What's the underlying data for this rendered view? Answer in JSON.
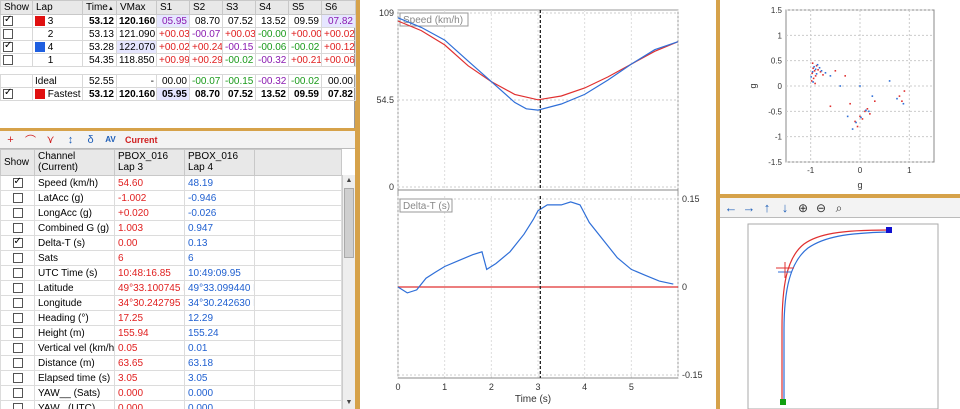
{
  "laps": {
    "headers": [
      "Show",
      "Lap",
      "Time",
      "VMax",
      "S1",
      "S2",
      "S3",
      "S4",
      "S5",
      "S6"
    ],
    "sort_indicator": "▲",
    "rows": [
      {
        "checked": true,
        "color": "#e01010",
        "lap": "3",
        "time": "53.12",
        "vmax": "120.160",
        "s": [
          "05.95",
          "08.70",
          "07.52",
          "13.52",
          "09.59",
          "07.82"
        ]
      },
      {
        "checked": false,
        "color": "",
        "lap": "2",
        "time": "53.13",
        "vmax": "121.090",
        "s": [
          "+00.03",
          "-00.07",
          "+00.03",
          "-00.00",
          "+00.00",
          "+00.02"
        ]
      },
      {
        "checked": true,
        "color": "#1f5fe0",
        "lap": "4",
        "time": "53.28",
        "vmax": "122.070",
        "s": [
          "+00.02",
          "+00.24",
          "-00.15",
          "-00.06",
          "-00.02",
          "+00.12"
        ]
      },
      {
        "checked": false,
        "color": "",
        "lap": "1",
        "time": "54.35",
        "vmax": "118.850",
        "s": [
          "+00.99",
          "+00.29",
          "-00.02",
          "-00.32",
          "+00.21",
          "+00.06"
        ]
      }
    ],
    "ideal": {
      "label": "Ideal",
      "time": "52.55",
      "vmax": "-",
      "s": [
        "00.00",
        "-00.07",
        "-00.15",
        "-00.32",
        "-00.02",
        "00.00"
      ]
    },
    "fastest": {
      "checked": true,
      "color": "#e01010",
      "label": "Fastest",
      "time": "53.12",
      "vmax": "120.160",
      "s": [
        "05.95",
        "08.70",
        "07.52",
        "13.52",
        "09.59",
        "07.82"
      ]
    }
  },
  "channel_toolbar": {
    "icons": [
      "add-marker-icon",
      "curve-icon",
      "split-icon",
      "sort-icon",
      "delta-icon",
      "av-icon"
    ],
    "glyphs": [
      "+",
      "⌒",
      "⋎",
      "↕",
      "δ",
      "AV"
    ],
    "current_label": "Current"
  },
  "channels": {
    "headers": {
      "show": "Show",
      "channel": "Channel",
      "channel_sub": "(Current)",
      "a_name": "PBOX_016",
      "a_lap": "Lap 3",
      "b_name": "PBOX_016",
      "b_lap": "Lap 4"
    },
    "rows": [
      {
        "checked": true,
        "name": "Speed (km/h)",
        "a": "54.60",
        "b": "48.19"
      },
      {
        "checked": false,
        "name": "LatAcc (g)",
        "a": "-1.002",
        "b": "-0.946"
      },
      {
        "checked": false,
        "name": "LongAcc (g)",
        "a": "+0.020",
        "b": "-0.026"
      },
      {
        "checked": false,
        "name": "Combined G (g)",
        "a": "1.003",
        "b": "0.947"
      },
      {
        "checked": true,
        "name": "Delta-T (s)",
        "a": "0.00",
        "b": "0.13"
      },
      {
        "checked": false,
        "name": "Sats",
        "a": "6",
        "b": "6"
      },
      {
        "checked": false,
        "name": "UTC Time (s)",
        "a": "10:48:16.85",
        "b": "10:49:09.95"
      },
      {
        "checked": false,
        "name": "Latitude",
        "a": "49°33.100745 N",
        "b": "49°33.099440 N"
      },
      {
        "checked": false,
        "name": "Longitude",
        "a": "34°30.242795 E",
        "b": "34°30.242630 E"
      },
      {
        "checked": false,
        "name": "Heading (°)",
        "a": "17.25",
        "b": "12.29"
      },
      {
        "checked": false,
        "name": "Height (m)",
        "a": "155.94",
        "b": "155.24"
      },
      {
        "checked": false,
        "name": "Vertical vel (km/h)",
        "a": "0.05",
        "b": "0.01"
      },
      {
        "checked": false,
        "name": "Distance (m)",
        "a": "63.65",
        "b": "63.18"
      },
      {
        "checked": false,
        "name": "Elapsed time (s)",
        "a": "3.05",
        "b": "3.05"
      },
      {
        "checked": false,
        "name": "YAW__ (Sats)",
        "a": "0.000",
        "b": "0.000"
      },
      {
        "checked": false,
        "name": "YAW_ (UTC)",
        "a": "0.000",
        "b": "0.000"
      }
    ]
  },
  "colors": {
    "lap_a": "#e03030",
    "lap_b": "#2f6fd8",
    "frame": "#d6a24a"
  },
  "chart_data": [
    {
      "type": "line",
      "title": "Speed (km/h)",
      "xlabel": "Time (s)",
      "xlim": [
        0,
        6
      ],
      "ylim": [
        0,
        109
      ],
      "ytick_labels": [
        "109",
        "54.5",
        "0"
      ],
      "cursor_x": 3.05,
      "series": [
        {
          "name": "Lap 3",
          "x": [
            0,
            0.5,
            1.0,
            1.5,
            2.0,
            2.5,
            3.0,
            3.5,
            4.0,
            4.5,
            5.0,
            5.5,
            6.0
          ],
          "values": [
            104,
            98,
            89,
            76,
            66,
            58,
            54.6,
            57,
            62,
            69,
            77,
            85,
            91
          ]
        },
        {
          "name": "Lap 4",
          "x": [
            0,
            0.5,
            1.0,
            1.5,
            2.0,
            2.5,
            2.75,
            3.0,
            3.5,
            4.0,
            4.5,
            5.0,
            5.5,
            6.0
          ],
          "values": [
            106,
            100,
            92,
            79,
            66,
            53,
            49,
            48.2,
            52,
            58,
            67,
            77,
            86,
            91
          ]
        }
      ]
    },
    {
      "type": "line",
      "title": "Delta-T (s)",
      "xlabel": "Time (s)",
      "xlim": [
        0,
        6
      ],
      "ylim": [
        -0.15,
        0.15
      ],
      "ytick_labels": [
        "0.15",
        "0",
        "-0.15"
      ],
      "xtick_labels": [
        "0",
        "1",
        "2",
        "3",
        "4",
        "5"
      ],
      "cursor_x": 3.05,
      "series": [
        {
          "name": "Lap 3",
          "x": [
            0,
            6
          ],
          "values": [
            0,
            0
          ]
        },
        {
          "name": "Lap 4",
          "x": [
            0,
            0.2,
            0.4,
            0.6,
            0.8,
            1.0,
            1.3,
            1.6,
            1.8,
            1.9,
            2.1,
            2.4,
            2.7,
            2.9,
            3.0,
            3.2,
            3.5,
            3.7,
            3.9,
            4.1,
            4.4,
            4.7,
            5.0,
            5.3,
            5.6,
            5.9
          ],
          "values": [
            0,
            -0.01,
            -0.005,
            0.015,
            0.025,
            0.035,
            0.045,
            0.055,
            0.06,
            0.03,
            0.04,
            0.06,
            0.09,
            0.115,
            0.13,
            0.14,
            0.14,
            0.145,
            0.14,
            0.11,
            0.08,
            0.05,
            0.03,
            0.02,
            0.01,
            0.005
          ]
        }
      ]
    },
    {
      "type": "scatter",
      "xlabel": "g",
      "ylabel": "g",
      "xlim": [
        -1.5,
        1.5
      ],
      "ylim": [
        -1.5,
        1.5
      ],
      "xtick_labels": [
        "-1",
        "0",
        "1"
      ],
      "ytick_labels": [
        "1.5",
        "1",
        "0.5",
        "0",
        "-0.5",
        "-1",
        "-1.5"
      ],
      "series": [
        {
          "name": "Lap 3",
          "x": [
            -0.95,
            -0.92,
            -0.97,
            -0.9,
            -0.85,
            -0.8,
            -0.75,
            -0.5,
            -0.98,
            -0.94,
            -0.91,
            0.0,
            0.05,
            -0.1,
            0.1,
            0.15,
            0.2,
            -0.05,
            0.8,
            0.85,
            0.9,
            -0.3,
            -0.6,
            0.3,
            -0.2,
            -0.88,
            -0.96
          ],
          "values": [
            0.35,
            0.3,
            0.25,
            0.2,
            0.32,
            0.28,
            0.22,
            0.3,
            0.1,
            0.15,
            0.05,
            -0.6,
            -0.65,
            -0.7,
            -0.5,
            -0.45,
            -0.55,
            -0.8,
            -0.2,
            -0.3,
            -0.1,
            0.2,
            -0.4,
            -0.3,
            -0.35,
            0.4,
            0.45
          ]
        },
        {
          "name": "Lap 4",
          "x": [
            -0.93,
            -0.9,
            -0.96,
            -0.88,
            -0.82,
            -0.78,
            -0.7,
            -0.6,
            -0.99,
            -0.95,
            0.02,
            -0.08,
            0.12,
            0.18,
            0.6,
            0.75,
            0.88,
            -0.4,
            -0.25,
            0.25,
            -0.15,
            0.0,
            -0.86
          ],
          "values": [
            0.38,
            0.33,
            0.28,
            0.24,
            0.36,
            0.3,
            0.26,
            0.2,
            0.18,
            0.08,
            -0.62,
            -0.72,
            -0.48,
            -0.5,
            0.1,
            -0.25,
            -0.35,
            0.0,
            -0.6,
            -0.2,
            -0.85,
            0.0,
            0.42
          ]
        }
      ]
    }
  ],
  "map": {
    "toolbar": {
      "icons": [
        "arrow-left-icon",
        "arrow-right-icon",
        "arrow-up-icon",
        "arrow-down-icon",
        "zoom-in-icon",
        "zoom-out-icon",
        "zoom-fit-icon"
      ],
      "glyphs": [
        "←",
        "→",
        "↑",
        "↓",
        "⊕",
        "⊖",
        "⌕"
      ]
    },
    "start_color": "#10a010",
    "end_color": "#1010d0"
  }
}
